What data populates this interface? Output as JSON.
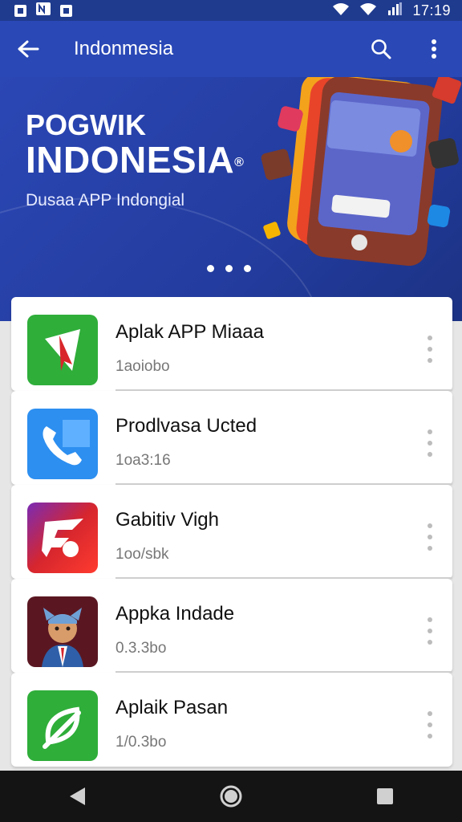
{
  "status_bar": {
    "time": "17:19",
    "icons": [
      "image-icon",
      "n-icon",
      "square-icon",
      "wifi-icon",
      "signal-icon",
      "battery-icon"
    ]
  },
  "app_bar": {
    "title": "Indonmesia",
    "icons": [
      "back-arrow-icon",
      "search-icon",
      "more-vert-icon"
    ]
  },
  "banner": {
    "line1": "POGWIK",
    "line2": "INDONESIA",
    "registered": "®",
    "subtitle": "Dusaa APP Indongial",
    "slides_total": 3
  },
  "apps": [
    {
      "title": "Aplak APP Miaaa",
      "subtitle": "1aoiobo",
      "icon": "red-arrow-app-icon",
      "accent": "#2fae3a"
    },
    {
      "title": "Prodlvasa Ucted",
      "subtitle": "1oa3:16",
      "icon": "phone-app-icon",
      "accent": "#2d8ff0"
    },
    {
      "title": "Gabitiv Vigh",
      "subtitle": "1oo/sbk",
      "icon": "red-swirl-app-icon",
      "accent": "#d6262e"
    },
    {
      "title": "Appka Indade",
      "subtitle": "0.3.3bo",
      "icon": "character-app-icon",
      "accent": "#5a1722"
    },
    {
      "title": "Aplaik Pasan",
      "subtitle": "1/0.3bo",
      "icon": "leaf-app-icon",
      "accent": "#2fae3a"
    }
  ],
  "colors": {
    "app_bar": "#2a48b6",
    "status_bar": "#1f3b8e",
    "nav_bar": "#141414"
  }
}
